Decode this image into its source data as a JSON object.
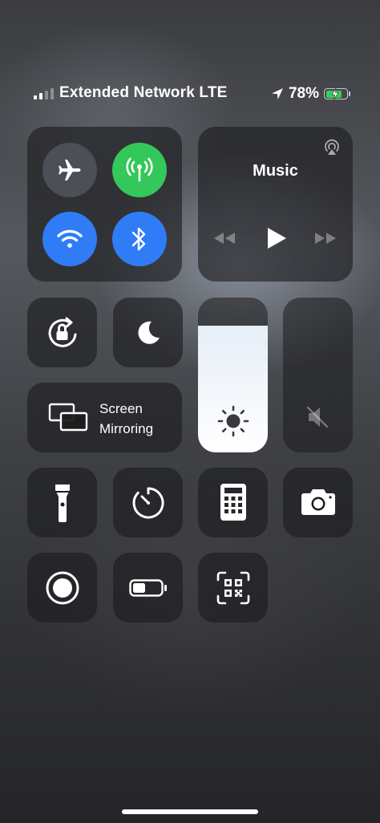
{
  "status_bar": {
    "carrier": "Extended Network LTE",
    "battery_percent": "78%",
    "battery_level": 0.78,
    "location_icon": "location-arrow-icon",
    "signal_bars_active": 2,
    "signal_bars_total": 4
  },
  "connectivity": {
    "airplane_mode": {
      "icon": "airplane-icon",
      "on": false
    },
    "cellular_data": {
      "icon": "antenna-icon",
      "on": true,
      "color": "#34c759"
    },
    "wifi": {
      "icon": "wifi-icon",
      "on": true,
      "color": "#2f7cf6"
    },
    "bluetooth": {
      "icon": "bluetooth-icon",
      "on": true,
      "color": "#2f7cf6"
    }
  },
  "music": {
    "title": "Music",
    "airplay_icon": "airplay-icon",
    "controls": [
      "rewind-icon",
      "play-icon",
      "fast-forward-icon"
    ]
  },
  "orientation_lock": {
    "icon": "rotation-lock-icon"
  },
  "do_not_disturb": {
    "icon": "moon-icon"
  },
  "screen_mirroring": {
    "label_line1": "Screen",
    "label_line2": "Mirroring",
    "icon": "screen-mirroring-icon"
  },
  "brightness": {
    "level": 0.82,
    "icon": "sun-icon"
  },
  "volume": {
    "level": 0.0,
    "icon": "speaker-muted-icon"
  },
  "shortcuts_row1": [
    "flashlight-icon",
    "timer-icon",
    "calculator-icon",
    "camera-icon"
  ],
  "shortcuts_row2": [
    "screen-record-icon",
    "low-power-battery-icon",
    "qr-code-scanner-icon"
  ],
  "colors": {
    "green": "#34c759",
    "blue": "#2f7cf6",
    "tile": "#1c1c1e",
    "off_circle": "#4b4f57"
  }
}
